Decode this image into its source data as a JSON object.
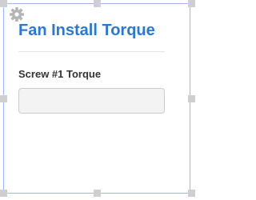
{
  "widget": {
    "title": "Fan Install Torque",
    "settings_icon": "gear-icon"
  },
  "field": {
    "label": "Screw #1 Torque",
    "value": "",
    "placeholder": ""
  },
  "colors": {
    "title": "#2a77d6",
    "selection_border": "#9fb3ff",
    "handle": "#cfcfcf",
    "input_background": "#f3f3f3",
    "input_border": "#cccccc"
  }
}
